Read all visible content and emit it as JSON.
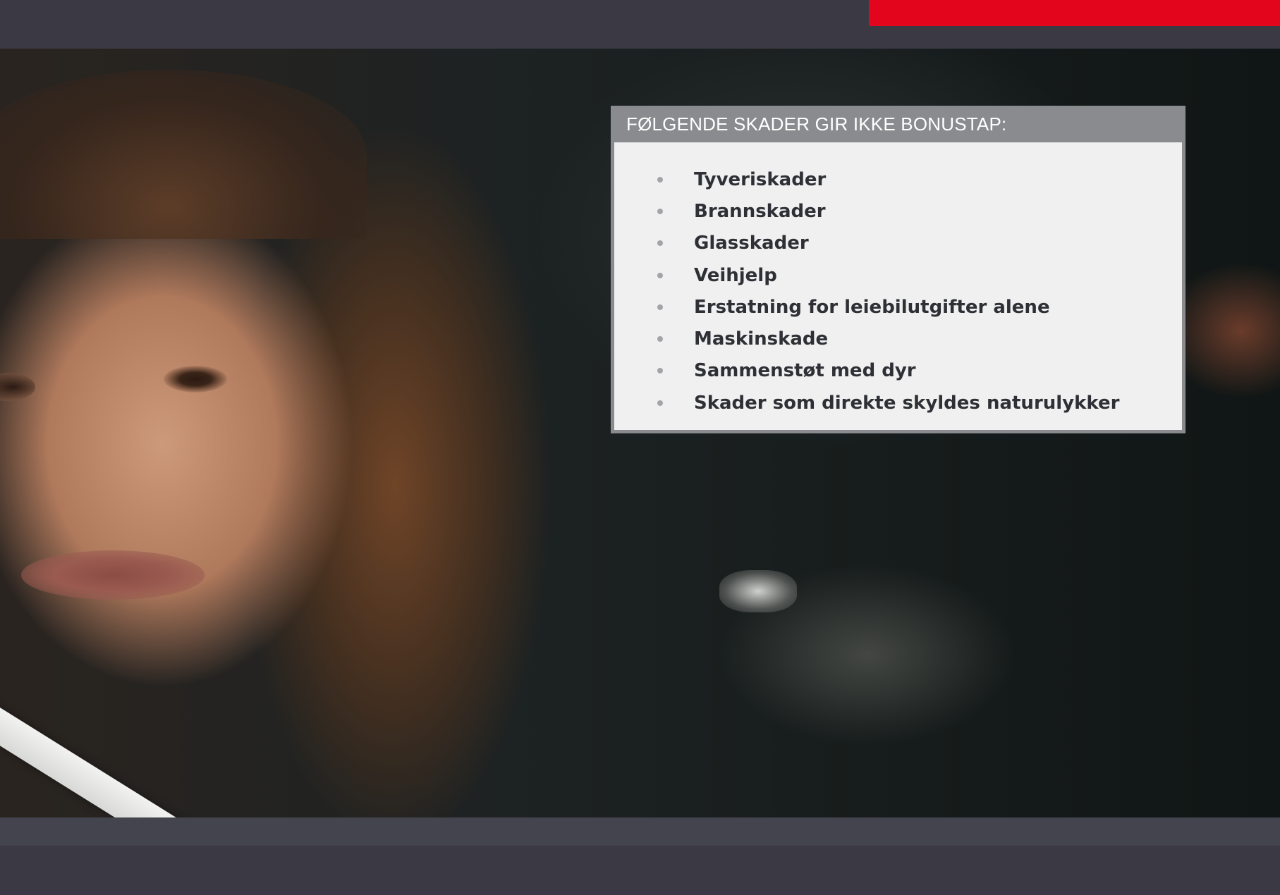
{
  "colors": {
    "accent": "#e3051b",
    "background": "#3b3a44",
    "box_header": "#8a8b8f",
    "box_body": "#eff0ef",
    "text_dark": "#2f3036"
  },
  "info_box": {
    "title": "FØLGENDE SKADER GIR IKKE BONUSTAP:",
    "items": [
      "Tyveriskader",
      "Brannskader",
      "Glasskader",
      "Veihjelp",
      "Erstatning for leiebilutgifter alene",
      "Maskinskade",
      "Sammenstøt med dyr",
      "Skader som direkte skyldes naturulykker"
    ]
  }
}
